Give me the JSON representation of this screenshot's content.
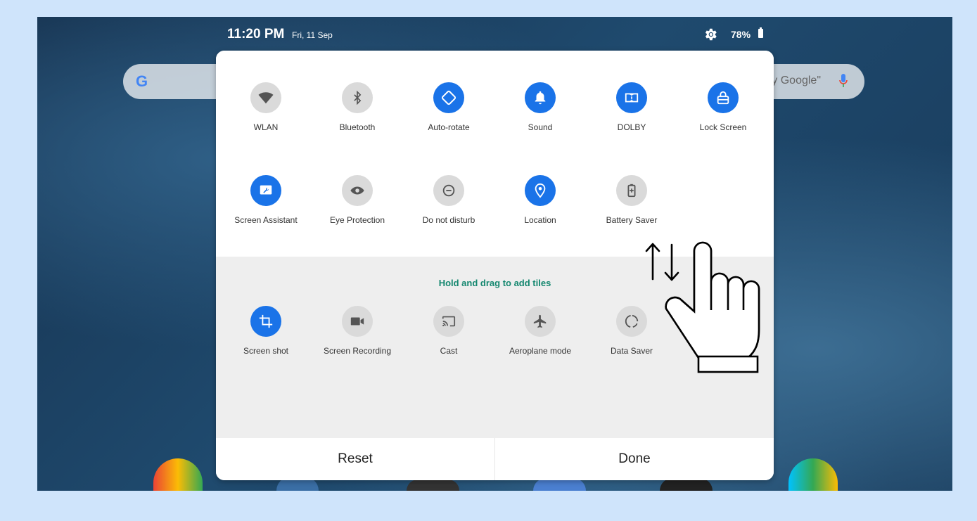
{
  "status_bar": {
    "time": "11:20 PM",
    "date": "Fri, 11 Sep",
    "battery_percent": "78%",
    "icons": [
      "gear-icon",
      "battery-icon"
    ]
  },
  "search_bar": {
    "logo": "G",
    "hint_text": "y Google\""
  },
  "panel": {
    "active_tiles": [
      {
        "label": "WLAN",
        "icon": "wifi-icon",
        "state": "off"
      },
      {
        "label": "Bluetooth",
        "icon": "bluetooth-icon",
        "state": "off"
      },
      {
        "label": "Auto-rotate",
        "icon": "auto-rotate-icon",
        "state": "on"
      },
      {
        "label": "Sound",
        "icon": "bell-icon",
        "state": "on"
      },
      {
        "label": "DOLBY",
        "icon": "dolby-icon",
        "state": "on"
      },
      {
        "label": "Lock Screen",
        "icon": "lock-icon",
        "state": "on"
      },
      {
        "label": "Screen Assistant",
        "icon": "wrench-icon",
        "state": "on"
      },
      {
        "label": "Eye Protection",
        "icon": "eye-icon",
        "state": "off"
      },
      {
        "label": "Do not disturb",
        "icon": "minus-circle-icon",
        "state": "off"
      },
      {
        "label": "Location",
        "icon": "location-pin-icon",
        "state": "on"
      },
      {
        "label": "Battery Saver",
        "icon": "battery-saver-icon",
        "state": "off"
      }
    ],
    "hint": "Hold and drag to add tiles",
    "available_tiles": [
      {
        "label": "Screen shot",
        "icon": "crop-icon",
        "state": "on"
      },
      {
        "label": "Screen Recording",
        "icon": "video-camera-icon",
        "state": "off"
      },
      {
        "label": "Cast",
        "icon": "cast-icon",
        "state": "off"
      },
      {
        "label": "Aeroplane mode",
        "icon": "airplane-icon",
        "state": "off"
      },
      {
        "label": "Data Saver",
        "icon": "data-saver-icon",
        "state": "off"
      }
    ],
    "reset_label": "Reset",
    "done_label": "Done"
  },
  "colors": {
    "accent": "#1a73e8",
    "hint_green": "#14876f",
    "inactive_tile": "#dadada",
    "page_bg": "#cfe4fb"
  }
}
